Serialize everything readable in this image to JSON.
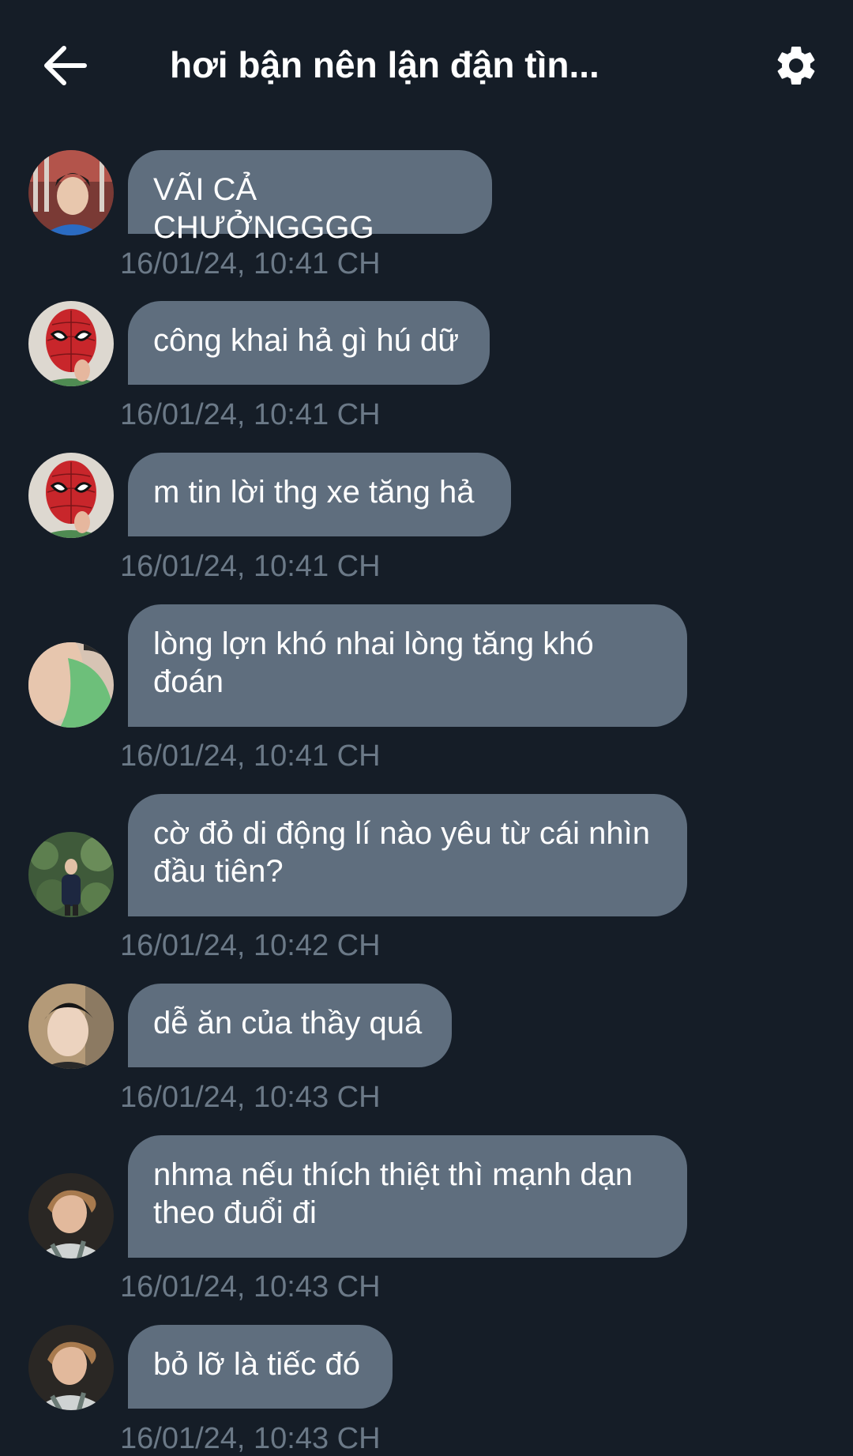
{
  "header": {
    "title": "hơi bận nên lận đận tìn...",
    "back_icon": "arrow-left-icon",
    "settings_icon": "gear-icon"
  },
  "colors": {
    "background": "#151d27",
    "bubble": "#5f6e7e",
    "timestamp": "#6b7987",
    "text": "#ffffff"
  },
  "messages": [
    {
      "text": "VÃI CẢ CHƯỞNGGGG",
      "time": "16/01/24, 10:41 CH",
      "avatar": "avatar-boy-blue-shirt"
    },
    {
      "text": "công khai hả gì hú dữ",
      "time": "16/01/24, 10:41 CH",
      "avatar": "avatar-spiderman-mask"
    },
    {
      "text": "m tin lời thg xe tăng hả",
      "time": "16/01/24, 10:41 CH",
      "avatar": "avatar-spiderman-mask"
    },
    {
      "text": "lòng lợn khó nhai lòng tăng khó đoán",
      "time": "16/01/24, 10:41 CH",
      "avatar": "avatar-green-shirt-closeup"
    },
    {
      "text": "cờ đỏ di động lí nào yêu từ cái nhìn đầu tiên?",
      "time": "16/01/24, 10:42 CH",
      "avatar": "avatar-person-in-garden"
    },
    {
      "text": "dễ ăn của thầy quá",
      "time": "16/01/24, 10:43 CH",
      "avatar": "avatar-boy-selfie"
    },
    {
      "text": "nhma nếu thích thiệt thì mạnh dạn theo đuổi đi",
      "time": "16/01/24, 10:43 CH",
      "avatar": "avatar-curly-hair-boy"
    },
    {
      "text": "bỏ lỡ là tiếc đó",
      "time": "16/01/24, 10:43 CH",
      "avatar": "avatar-curly-hair-boy"
    }
  ]
}
